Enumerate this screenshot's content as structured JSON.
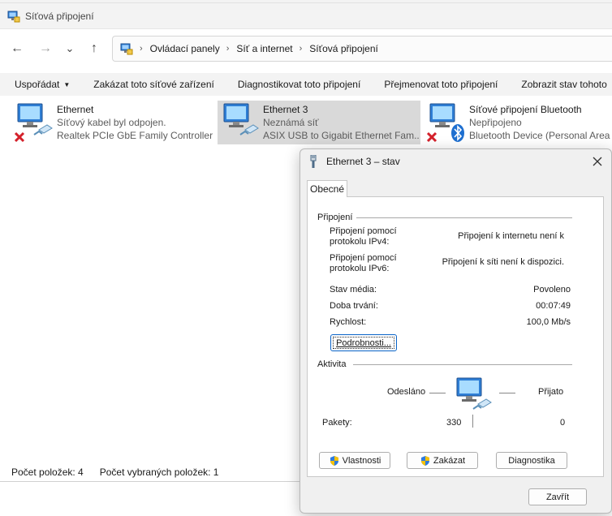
{
  "window": {
    "title": "Síťová připojení"
  },
  "nav": {
    "back_glyph": "←",
    "forward_glyph": "→",
    "recent_glyph": "⌄",
    "up_glyph": "↑"
  },
  "address": {
    "crumbs": [
      "Ovládací panely",
      "Síť a internet",
      "Síťová připojení"
    ],
    "separator": "›"
  },
  "commands": [
    {
      "label": "Uspořádat",
      "has_dropdown": true
    },
    {
      "label": "Zakázat toto síťové zařízení"
    },
    {
      "label": "Diagnostikovat toto připojení"
    },
    {
      "label": "Přejmenovat toto připojení"
    },
    {
      "label": "Zobrazit stav tohoto"
    }
  ],
  "connections": [
    {
      "name": "Ethernet",
      "status": "Síťový kabel byl odpojen.",
      "device": "Realtek PCIe GbE Family Controller",
      "badge": "red-x-icon",
      "selected": false
    },
    {
      "name": "Ethernet 3",
      "status": "Neznámá síť",
      "device": "ASIX USB to Gigabit Ethernet Fam...",
      "badge": null,
      "selected": true
    },
    {
      "name": "Síťové připojení Bluetooth",
      "status": "Nepřipojeno",
      "device": "Bluetooth Device (Personal Area ...",
      "badge": "red-x-icon",
      "selected": false
    }
  ],
  "statusbar": {
    "item_count": "Počet položek: 4",
    "selected_count": "Počet vybraných položek: 1"
  },
  "dialog": {
    "title": "Ethernet 3 – stav",
    "tab": "Obecné",
    "connection_group": "Připojení",
    "ipv4_label_1": "Připojení pomocí",
    "ipv4_label_2": "protokolu IPv4:",
    "ipv4_value": "Připojení k internetu není k",
    "ipv6_label_1": "Připojení pomocí",
    "ipv6_label_2": "protokolu IPv6:",
    "ipv6_value": "Připojení k síti není k dispozici.",
    "media_label": "Stav média:",
    "media_value": "Povoleno",
    "duration_label": "Doba trvání:",
    "duration_value": "00:07:49",
    "speed_label": "Rychlost:",
    "speed_value": "100,0 Mb/s",
    "details_button": "Podrobnosti...",
    "activity_group": "Aktivita",
    "sent_label": "Odesláno",
    "received_label": "Přijato",
    "packets_label": "Pakety:",
    "packets_sent": "330",
    "packets_received": "0",
    "properties_button": "Vlastnosti",
    "disable_button": "Zakázat",
    "diagnose_button": "Diagnostika",
    "close_button": "Zavřít"
  },
  "colors": {
    "selection": "#d9d9d9",
    "monitor_blue": "#2f7fd6",
    "error_red": "#d4212b",
    "bluetooth_blue": "#1e6fd0"
  }
}
